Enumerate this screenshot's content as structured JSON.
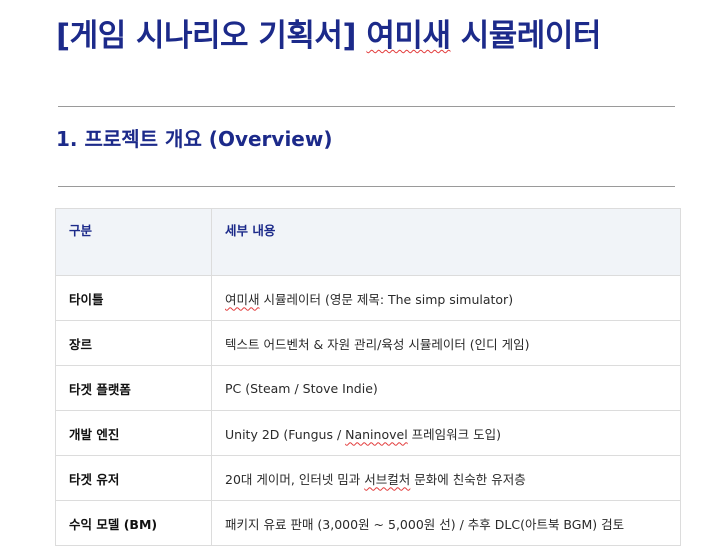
{
  "document": {
    "title_prefix": "[게임 시나리오 기획서] ",
    "title_mark": "여미새",
    "title_suffix": " 시뮬레이터",
    "section_title": "1. 프로젝트 개요 (Overview)"
  },
  "table": {
    "headers": [
      "구분",
      "세부 내용"
    ],
    "rows": [
      {
        "label": "타이틀",
        "v1": "",
        "mark": "여미새",
        "v2": " 시뮬레이터 (영문 제목: The simp simulator)"
      },
      {
        "label": "장르",
        "v1": "텍스트 어드벤처 & 자원 관리/육성 시뮬레이터 (인디 게임)",
        "mark": "",
        "v2": ""
      },
      {
        "label": "타겟 플랫폼",
        "v1": "PC (Steam / Stove Indie)",
        "mark": "",
        "v2": ""
      },
      {
        "label": "개발 엔진",
        "v1": "Unity 2D (Fungus / ",
        "mark": "Naninovel",
        "v2": " 프레임워크 도입)"
      },
      {
        "label": "타겟 유저",
        "v1": "20대 게이머, 인터넷 밈과 ",
        "mark": "서브컬처",
        "v2": " 문화에 친숙한 유저층"
      },
      {
        "label": "수익 모델 (BM)",
        "v1": "패키지 유료 판매 (3,000원 ~ 5,000원 선) / 추후 DLC(아트북 BGM) 검토",
        "mark": "",
        "v2": ""
      }
    ]
  }
}
